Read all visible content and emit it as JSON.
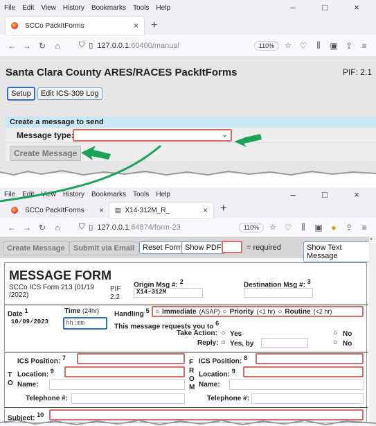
{
  "browser": {
    "menu": [
      "File",
      "Edit",
      "View",
      "History",
      "Bookmarks",
      "Tools",
      "Help"
    ],
    "controls": {
      "minimize": "–",
      "maximize": "□",
      "close": "×"
    }
  },
  "top": {
    "tab_title": "SCCo PackItForms",
    "tab_close": "×",
    "new_tab": "+",
    "url_host": "127.0.0.1",
    "url_path": ":60400/manual",
    "zoom": "110%",
    "page_title": "Santa Clara County ARES/RACES PackItForms",
    "pif": "PIF: 2.1",
    "setup_label": "Setup",
    "edit_log_label": "Edit ICS-309 Log",
    "create_section_title": "Create a message to send",
    "message_type_label": "Message type:",
    "create_message_label": "Create Message"
  },
  "bottom": {
    "tabs": [
      {
        "title": "SCCo PackItForms",
        "close": "×"
      },
      {
        "title": "X14-312M_R_",
        "close": "×"
      }
    ],
    "new_tab": "+",
    "url_host": "127.0.0.1",
    "url_path": ":64874/form-23",
    "zoom": "110%",
    "toolbar": {
      "create_message": "Create Message",
      "submit_email": "Submit via Email",
      "reset_form": "Reset Form",
      "show_pdf": "Show PDF",
      "required_note": "= required",
      "show_text": "Show Text Message"
    },
    "form": {
      "title": "MESSAGE FORM",
      "subtitle": "SCCo ICS Form 213 (01/19 /2022)",
      "pif_label": "PIF",
      "pif_value": "2.2",
      "origin_label": "Origin Msg #:",
      "origin_sup": "2",
      "origin_value": "X14-312M",
      "dest_label": "Destination Msg #:",
      "dest_sup": "3",
      "date_label": "Date",
      "date_sup": "1",
      "date_value": "10/09/2023",
      "time_label": "Time",
      "time_hint": "(24hr)",
      "time_placeholder": "hh:mm",
      "handling_label": "Handling",
      "handling_sup": "5",
      "immediate": "Immediate",
      "immediate_hint": "(ASAP)",
      "priority": "Priority",
      "priority_hint": "(<1 hr)",
      "routine": "Routine",
      "routine_hint": "(<2 hr)",
      "requests_label": "This message requests you to",
      "requests_sup": "6",
      "take_action": "Take Action:",
      "reply": "Reply:",
      "yes": "Yes",
      "yes_by": "Yes, by",
      "no": "No",
      "to_letters": [
        "T",
        "O"
      ],
      "from_letters": [
        "F",
        "R",
        "O",
        "M"
      ],
      "ics_position": "ICS Position:",
      "to_pos_sup": "7",
      "from_pos_sup": "8",
      "location": "Location:",
      "loc_sup": "9",
      "name": "Name:",
      "telephone": "Telephone #:",
      "subject": "Subject:",
      "subject_sup": "10"
    }
  },
  "colors": {
    "accent_blue": "#2e6fce",
    "required_red": "#d86a6a",
    "arrow_green": "#1aa35a",
    "section_blue": "#c9e7f5"
  }
}
